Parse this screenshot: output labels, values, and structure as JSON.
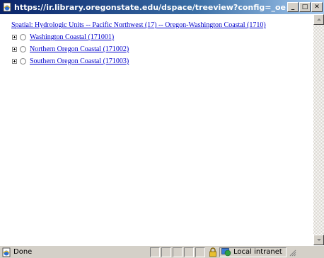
{
  "window": {
    "title": "https://ir.library.oregonstate.edu/dspace/treeview?config=_oerbcoastal...",
    "minimize_glyph": "_",
    "maximize_glyph": "□",
    "close_glyph": "✕"
  },
  "content": {
    "breadcrumb": "Spatial: Hydrologic Units -- Pacific Northwest (17) -- Oregon-Washington Coastal (1710)",
    "tree": [
      {
        "label": "Washington Coastal (171001)"
      },
      {
        "label": "Northern Oregon Coastal (171002)"
      },
      {
        "label": "Southern Oregon Coastal (171003)"
      }
    ]
  },
  "status": {
    "text": "Done",
    "zone": "Local intranet"
  },
  "icons": {
    "title": "ie-page-icon",
    "status": "ie-page-icon",
    "lock": "lock-icon",
    "zone": "intranet-globe-icon"
  },
  "colors": {
    "link": "#0000cc",
    "titlebar_start": "#0a246a",
    "titlebar_end": "#a6caf0",
    "chrome": "#d4d0c8"
  }
}
